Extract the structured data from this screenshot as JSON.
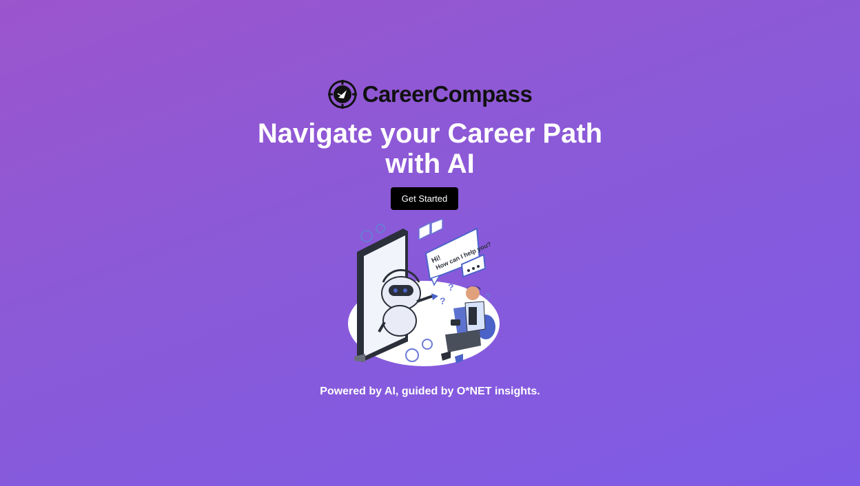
{
  "brand": {
    "logo_icon": "compass-target-icon",
    "name": "CareerCompass"
  },
  "hero": {
    "headline_line1": "Navigate your Career Path",
    "headline_line2": "with AI",
    "cta_label": "Get Started"
  },
  "illustration": {
    "bubble_text_1": "Hi!",
    "bubble_text_2": "How can I help you?",
    "icon": "ai-chatbot-illustration"
  },
  "footer": {
    "tagline": "Powered by AI, guided by O*NET insights."
  },
  "colors": {
    "gradient_start": "#9b55cd",
    "gradient_end": "#7e5be6",
    "button_bg": "#000000",
    "accent_blue": "#4b63c9"
  }
}
